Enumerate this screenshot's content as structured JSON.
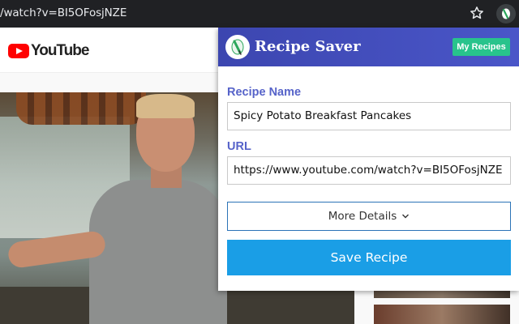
{
  "browser": {
    "url_text": "/watch?v=BI5OFosjNZE",
    "star_icon": "star-icon",
    "extension_icon": "recipe-saver-icon"
  },
  "youtube": {
    "logo_text": "YouTube",
    "brand_color": "#ff0000"
  },
  "popup": {
    "title": "Recipe Saver",
    "my_recipes_label": "My Recipes",
    "recipe_name_label": "Recipe Name",
    "recipe_name_value": "Spicy Potato Breakfast Pancakes",
    "url_label": "URL",
    "url_value": "https://www.youtube.com/watch?v=BI5OFosjNZE",
    "more_details_label": "More Details",
    "save_label": "Save Recipe",
    "colors": {
      "header": "#4a56c8",
      "accent_label": "#5663c9",
      "my_recipes": "#28c38c",
      "save_button": "#1a9ee6"
    }
  }
}
